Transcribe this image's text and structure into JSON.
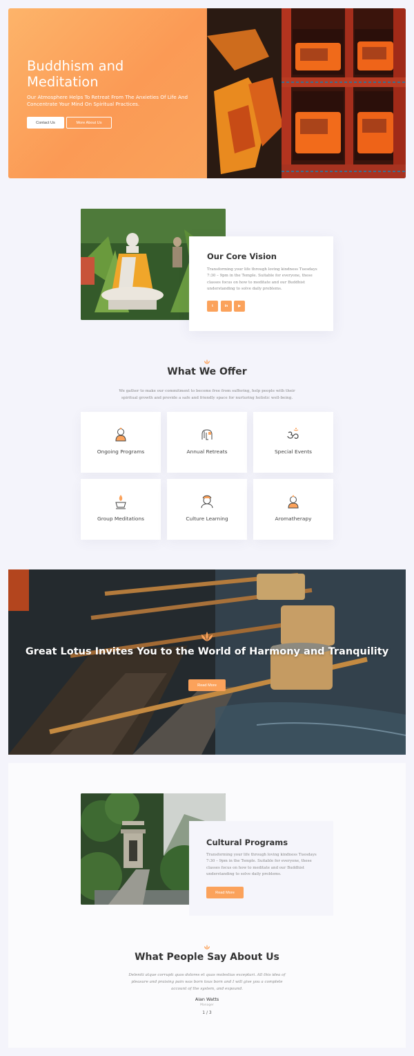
{
  "hero": {
    "title": "Buddhism and Meditation",
    "subtitle": "Our Atmosphere Helps To Retreat From The Anxieties Of Life And Concentrate Your Mind On Spiritual Practices.",
    "contact_label": "Contact Us",
    "more_label": "More About Us"
  },
  "vision": {
    "title": "Our Core Vision",
    "text": "Transforming your life through loving kindness Tuesdays 7:30 – 9pm in the Temple. Suitable for everyone, these classes focus on how to meditate and our Buddhist understanding to solve daily problems.",
    "socials": [
      {
        "label": "t",
        "icon": "twitter-icon"
      },
      {
        "label": "in",
        "icon": "linkedin-icon"
      },
      {
        "label": "▶",
        "icon": "youtube-icon"
      }
    ]
  },
  "offer": {
    "title": "What We Offer",
    "desc": "We gather to make our commitment to become free from suffering, help people with their spiritual growth and provide a safe and friendly space for nurturing holistic well-being.",
    "items": [
      {
        "label": "Ongoing Programs",
        "icon": "buddha-icon"
      },
      {
        "label": "Annual Retreats",
        "icon": "elephant-icon"
      },
      {
        "label": "Special Events",
        "icon": "om-icon"
      },
      {
        "label": "Group Meditations",
        "icon": "flame-bowl-icon"
      },
      {
        "label": "Culture Learning",
        "icon": "deity-icon"
      },
      {
        "label": "Aromatherapy",
        "icon": "monk-icon"
      }
    ]
  },
  "banner": {
    "title": "Great Lotus Invites You to the World of Harmony and Tranquility",
    "button_label": "Read More"
  },
  "cultural": {
    "title": "Cultural Programs",
    "text": "Transforming your life through loving kindness Tuesdays 7:30 – 9pm in the Temple. Suitable for everyone, these classes focus on how to meditate and our Buddhist understanding to solve daily problems.",
    "button_label": "Read More"
  },
  "testimonials": {
    "title": "What People Say About Us",
    "quote": "Deleniti atque corrupti quos dolores et quas molestias excepturi. All this idea of pleasure and praising pain was born tous born and I will give you a complete account of the system, and expound.",
    "author": "Alan Watts",
    "role": "Manager",
    "pager": "1 / 3"
  },
  "colors": {
    "accent": "#fba25b",
    "hero_gradient_start": "#fdb46a",
    "hero_gradient_end": "#fb9a55",
    "background": "#f4f4fb"
  }
}
